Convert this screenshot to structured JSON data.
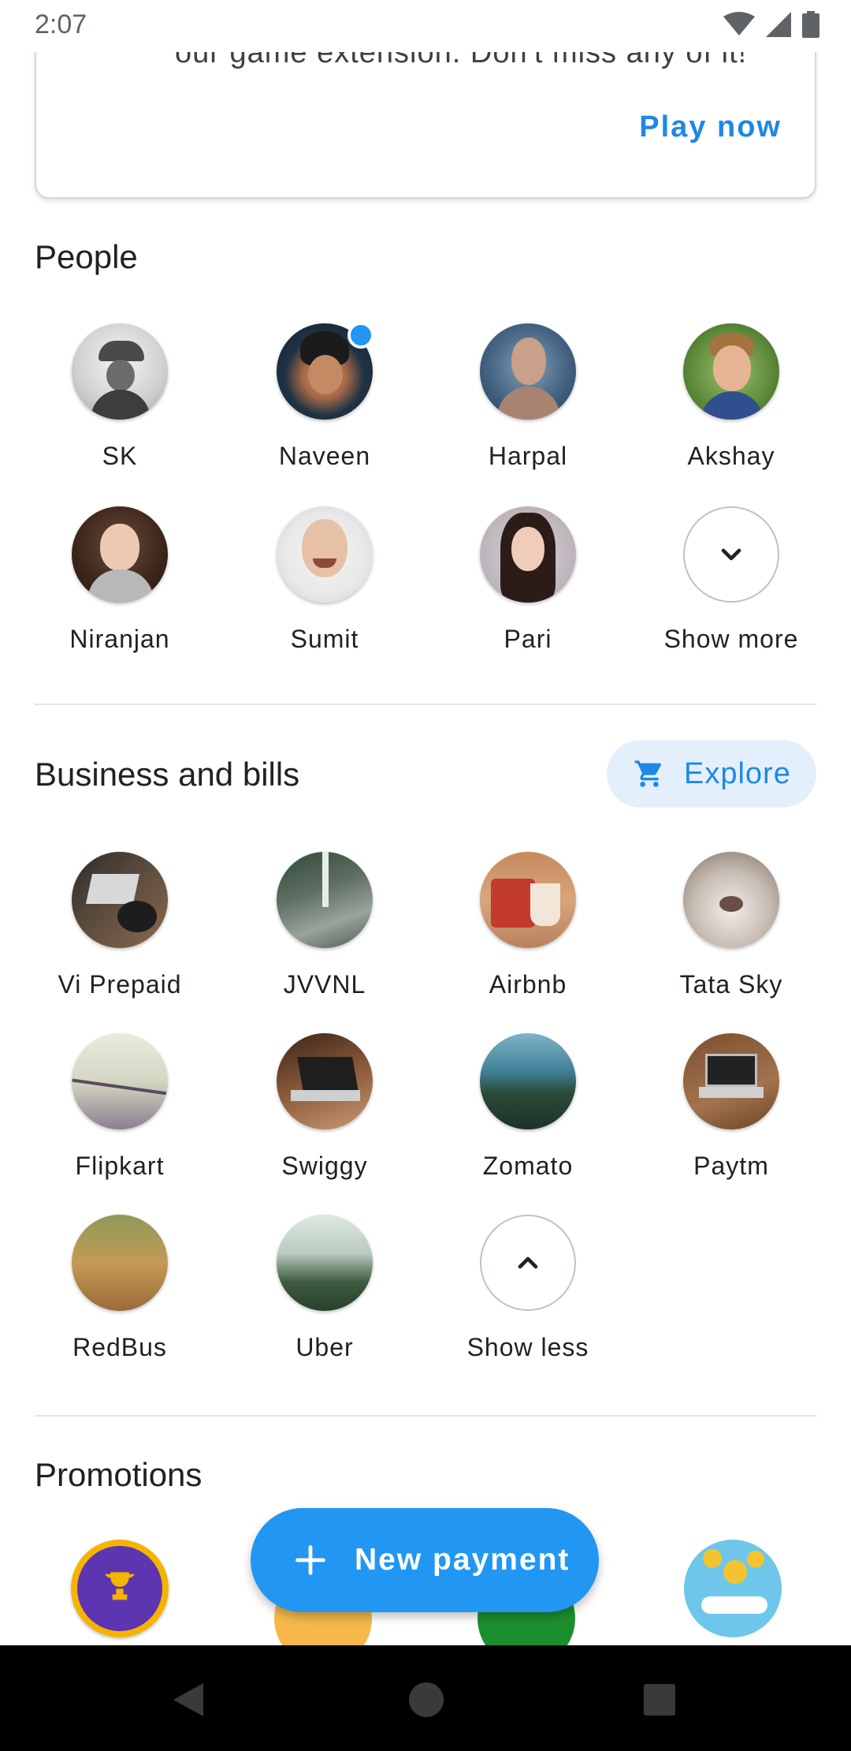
{
  "status_bar": {
    "time": "2:07"
  },
  "promo_card": {
    "truncated_text": "our game extension. Don't miss any of it!",
    "action_label": "Play now"
  },
  "people": {
    "title": "People",
    "items": [
      {
        "name": "SK"
      },
      {
        "name": "Naveen",
        "has_new": true
      },
      {
        "name": "Harpal"
      },
      {
        "name": "Akshay"
      },
      {
        "name": "Niranjan"
      },
      {
        "name": "Sumit"
      },
      {
        "name": "Pari"
      }
    ],
    "show_more_label": "Show more"
  },
  "business": {
    "title": "Business and bills",
    "explore_label": "Explore",
    "items": [
      {
        "name": "Vi Prepaid"
      },
      {
        "name": "JVVNL"
      },
      {
        "name": "Airbnb"
      },
      {
        "name": "Tata Sky"
      },
      {
        "name": "Flipkart"
      },
      {
        "name": "Swiggy"
      },
      {
        "name": "Zomato"
      },
      {
        "name": "Paytm"
      },
      {
        "name": "RedBus"
      },
      {
        "name": "Uber"
      }
    ],
    "show_less_label": "Show less"
  },
  "promotions": {
    "title": "Promotions"
  },
  "fab": {
    "label": "New payment"
  },
  "colors": {
    "accent": "#2196f3",
    "accent_text": "#1e88e5",
    "explore_bg": "#e3f0fc"
  }
}
